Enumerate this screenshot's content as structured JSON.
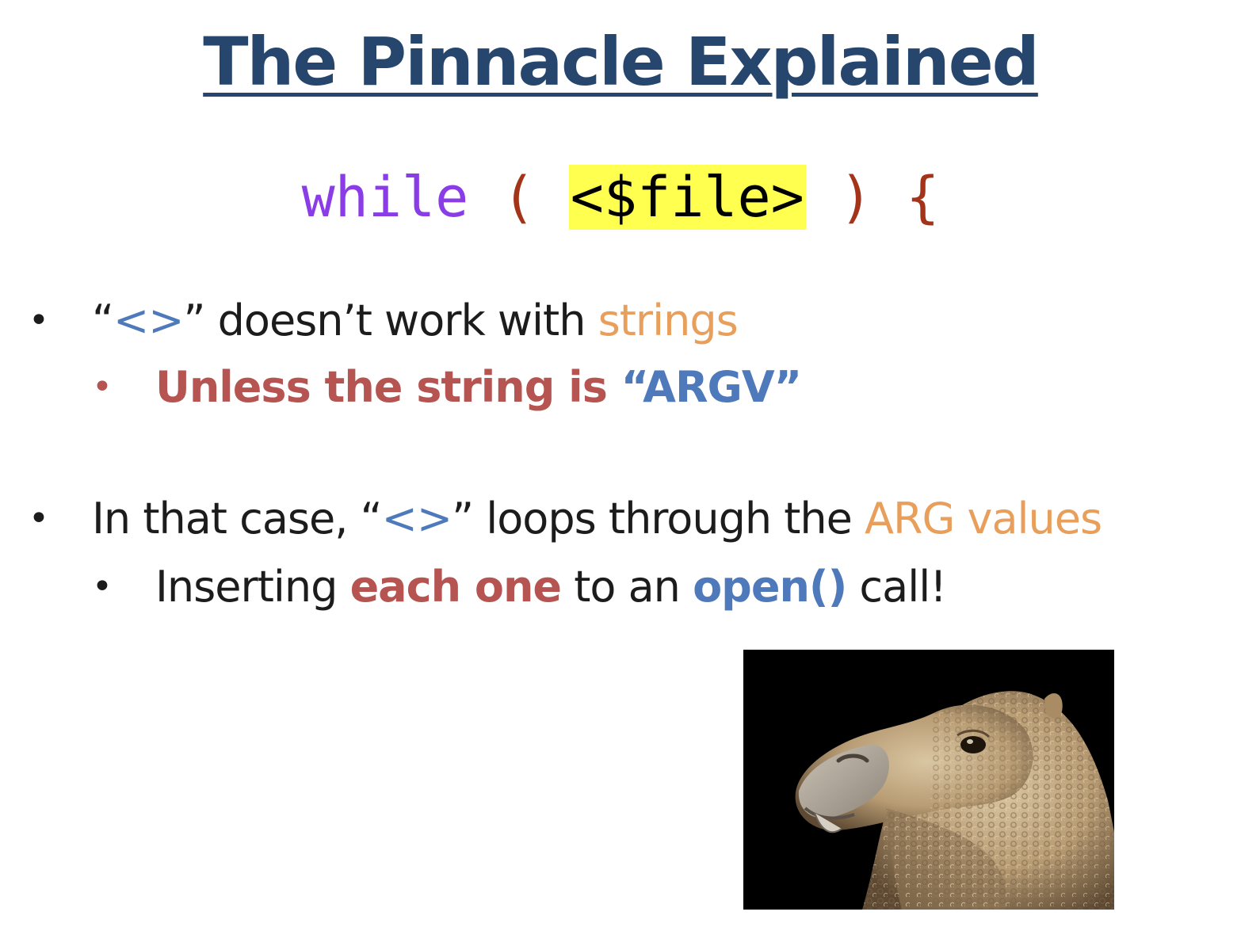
{
  "title": "The Pinnacle Explained",
  "code": {
    "keyword": "while",
    "open_paren": "(",
    "highlighted": "<$file>",
    "close": ") {"
  },
  "bullets": {
    "b1": {
      "q_open": "“",
      "op": "<>",
      "q_close": "”",
      "text": " doesn’t work with ",
      "accent": "strings"
    },
    "b1_sub": {
      "text": "Unless the string is ",
      "accent": "“ARGV”"
    },
    "b2": {
      "pre": "In that case, “",
      "op": "<>",
      "post": "” loops through the ",
      "accent": "ARG values"
    },
    "b2_sub": {
      "pre": "Inserting ",
      "red": "each one",
      "mid": " to an ",
      "blue": "open()",
      "post": " call!"
    },
    "bullet_glyph": "•"
  },
  "image": {
    "icon": "camel-image"
  },
  "colors": {
    "title": "#26466e",
    "keyword": "#8a3ce6",
    "paren": "#a33419",
    "highlight": "#ffff4f",
    "blue": "#4e79bb",
    "orange": "#e99f5c",
    "red": "#b55450"
  }
}
